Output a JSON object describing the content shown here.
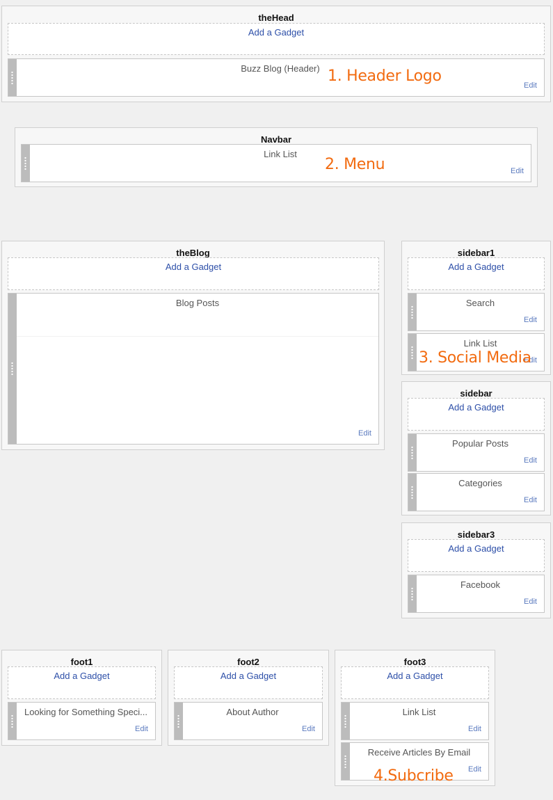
{
  "common": {
    "add_gadget": "Add a Gadget",
    "edit": "Edit"
  },
  "theHead": {
    "title": "theHead",
    "header_widget": "Buzz Blog (Header)"
  },
  "navbar": {
    "title": "Navbar",
    "linklist": "Link List"
  },
  "theBlog": {
    "title": "theBlog",
    "blog_posts": "Blog Posts"
  },
  "sidebar1": {
    "title": "sidebar1",
    "search": "Search",
    "linklist": "Link List"
  },
  "sidebar": {
    "title": "sidebar",
    "popular_posts": "Popular Posts",
    "categories": "Categories"
  },
  "sidebar3": {
    "title": "sidebar3",
    "facebook": "Facebook"
  },
  "foot1": {
    "title": "foot1",
    "widget": "Looking for Something Speci..."
  },
  "foot2": {
    "title": "foot2",
    "widget": "About Author"
  },
  "foot3": {
    "title": "foot3",
    "linklist": "Link List",
    "subscribe": "Receive Articles By Email"
  },
  "annotations": {
    "header_logo": "1. Header Logo",
    "menu": "2. Menu",
    "social_media": "3. Social Media",
    "subscribe": "4.Subcribe"
  },
  "colors": {
    "annotation": "#f26b10",
    "link": "#2d4fa8",
    "edit": "#5b7bbf"
  }
}
